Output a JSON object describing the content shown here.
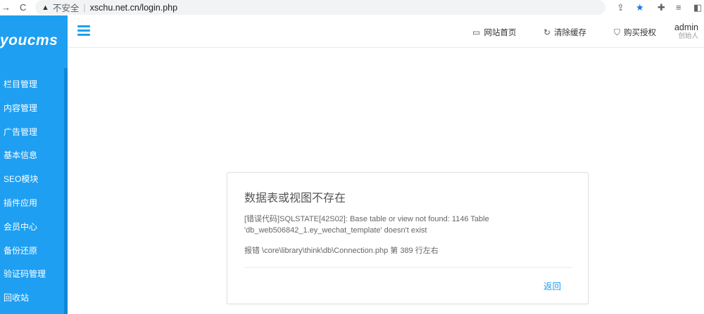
{
  "browser": {
    "back_glyph": "→",
    "reload_glyph": "C",
    "insecure_label": "不安全",
    "url": "xschu.net.cn/login.php"
  },
  "sidebar": {
    "logo": "youcms",
    "items": [
      {
        "label": "栏目管理"
      },
      {
        "label": "内容管理"
      },
      {
        "label": "广告管理"
      },
      {
        "label": "基本信息"
      },
      {
        "label": "SEO模块"
      },
      {
        "label": "插件应用"
      },
      {
        "label": "会员中心"
      },
      {
        "label": "备份还原"
      },
      {
        "label": "验证码管理"
      },
      {
        "label": "回收站"
      }
    ]
  },
  "header": {
    "links": [
      {
        "label": "网站首页",
        "icon": "monitor-icon"
      },
      {
        "label": "清除缓存",
        "icon": "refresh-icon"
      },
      {
        "label": "购买授权",
        "icon": "shield-icon"
      }
    ],
    "user": {
      "name": "admin",
      "role": "创始人"
    }
  },
  "error": {
    "title": "数据表或视图不存在",
    "message": "[错误代码]SQLSTATE[42S02]: Base table or view not found: 1146 Table 'db_web506842_1.ey_wechat_template' doesn't exist",
    "location": "报错 \\core\\library\\think\\db\\Connection.php 第 389 行左右",
    "back_label": "返回"
  },
  "colors": {
    "sidebar": "#1e9ff2",
    "accent": "#1e9ff2"
  }
}
